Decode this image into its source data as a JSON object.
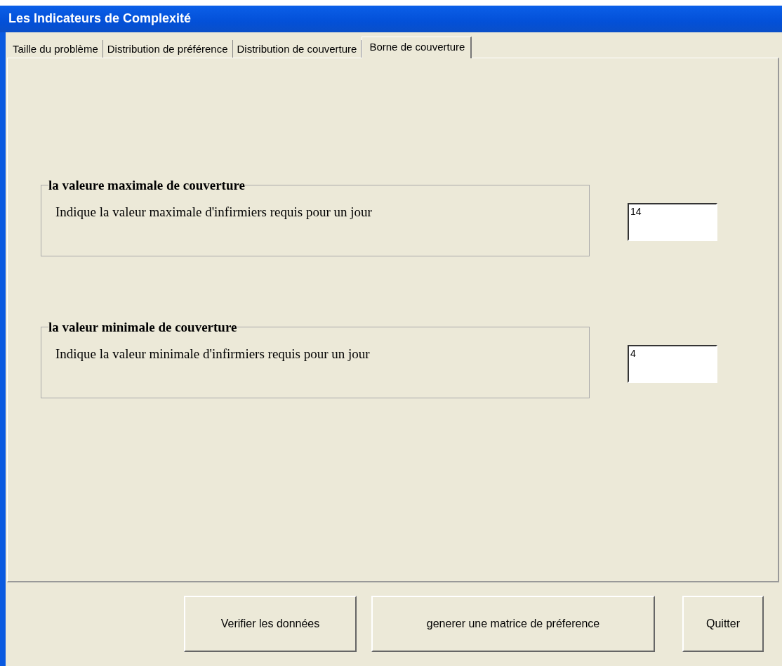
{
  "window": {
    "title": "Les Indicateurs de Complexité"
  },
  "tabs": [
    {
      "label": "Taille du problème",
      "selected": false
    },
    {
      "label": "Distribution de préférence",
      "selected": false
    },
    {
      "label": "Distribution de couverture",
      "selected": false
    },
    {
      "label": "Borne de couverture",
      "selected": true
    }
  ],
  "groups": [
    {
      "title": "la valeure maximale de couverture",
      "label": "Indique la valeur maximale d'infirmiers requis pour un jour",
      "value": "14"
    },
    {
      "title": "la valeur minimale de couverture",
      "label": "Indique la valeur minimale d'infirmiers requis pour un jour",
      "value": "4"
    }
  ],
  "buttons": [
    "Verifier les données",
    "generer une matrice de préference",
    "Quitter"
  ]
}
